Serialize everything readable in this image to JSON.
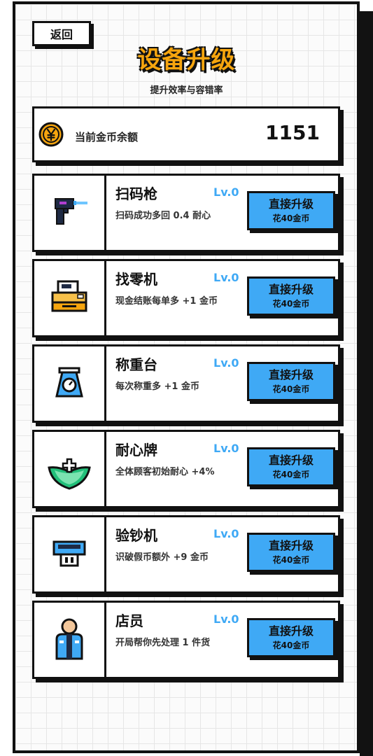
{
  "header": {
    "back_label": "返回",
    "title": "设备升级",
    "subtitle": "提升效率与容错率"
  },
  "balance": {
    "coin_icon": "yen-coin-icon",
    "label": "当前金币余额",
    "value": "1151"
  },
  "items": [
    {
      "icon": "scanner-gun-icon",
      "name": "扫码枪",
      "level": "Lv.0",
      "desc": "扫码成功多回 0.4 耐心",
      "button": "直接升级",
      "cost": "花40金币"
    },
    {
      "icon": "cash-register-icon",
      "name": "找零机",
      "level": "Lv.0",
      "desc": "现金结账每单多 +1 金币",
      "button": "直接升级",
      "cost": "花40金币"
    },
    {
      "icon": "scale-icon",
      "name": "称重台",
      "level": "Lv.0",
      "desc": "每次称重多 +1 金币",
      "button": "直接升级",
      "cost": "花40金币"
    },
    {
      "icon": "patience-badge-icon",
      "name": "耐心牌",
      "level": "Lv.0",
      "desc": "全体顾客初始耐心 +4%",
      "button": "直接升级",
      "cost": "花40金币"
    },
    {
      "icon": "money-checker-icon",
      "name": "验钞机",
      "level": "Lv.0",
      "desc": "识破假币额外 +9 金币",
      "button": "直接升级",
      "cost": "花40金币"
    },
    {
      "icon": "clerk-icon",
      "name": "店员",
      "level": "Lv.0",
      "desc": "开局帮你先处理 1 件货",
      "button": "直接升级",
      "cost": "花40金币"
    }
  ],
  "colors": {
    "accent_gold": "#f6a50e",
    "level_blue": "#3fa9f5",
    "button_blue": "#3fa9f5",
    "border": "#111111"
  }
}
